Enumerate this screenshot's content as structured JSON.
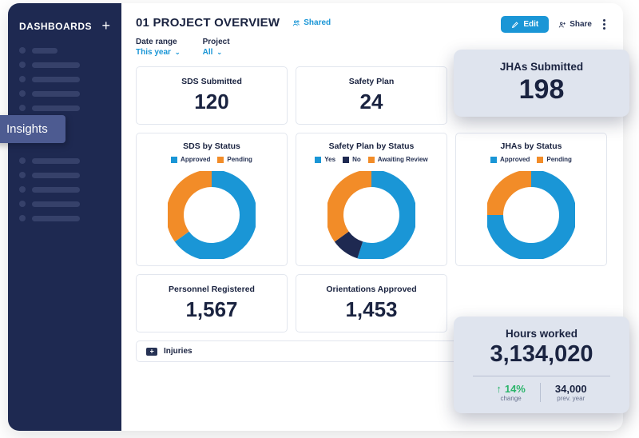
{
  "sidebar": {
    "title": "DASHBOARDS",
    "insights_label": "Insights"
  },
  "header": {
    "title": "01 PROJECT OVERVIEW",
    "shared_label": "Shared",
    "edit_label": "Edit",
    "share_label": "Share"
  },
  "filters": {
    "date_range_label": "Date range",
    "date_range_value": "This year",
    "project_label": "Project",
    "project_value": "All"
  },
  "stats": {
    "sds_submitted": {
      "title": "SDS Submitted",
      "value": "120"
    },
    "safety_plan": {
      "title": "Safety Plan",
      "value": "24"
    },
    "jhas_submitted": {
      "title": "JHAs Submitted",
      "value": "198"
    },
    "personnel": {
      "title": "Personnel Registered",
      "value": "1,567"
    },
    "orientations": {
      "title": "Orientations Approved",
      "value": "1,453"
    },
    "hours": {
      "title": "Hours worked",
      "value": "3,134,020",
      "change_pct": "14%",
      "change_label": "change",
      "prev_value": "34,000",
      "prev_label": "prev. year"
    },
    "injuries_title": "Injuries"
  },
  "charts": {
    "sds": {
      "title": "SDS by Status",
      "legend": [
        "Approved",
        "Pending"
      ]
    },
    "safety": {
      "title": "Safety Plan by Status",
      "legend": [
        "Yes",
        "No",
        "Awaiting Review"
      ]
    },
    "jhas": {
      "title": "JHAs by Status",
      "legend": [
        "Approved",
        "Pending"
      ]
    }
  },
  "colors": {
    "blue": "#1a96d6",
    "orange": "#f28c28",
    "navy": "#1e2951"
  },
  "chart_data": [
    {
      "type": "pie",
      "title": "SDS by Status",
      "series": [
        {
          "name": "Approved",
          "value": 65,
          "color": "#1a96d6"
        },
        {
          "name": "Pending",
          "value": 35,
          "color": "#f28c28"
        }
      ]
    },
    {
      "type": "pie",
      "title": "Safety Plan by Status",
      "series": [
        {
          "name": "Yes",
          "value": 55,
          "color": "#1a96d6"
        },
        {
          "name": "No",
          "value": 10,
          "color": "#1e2951"
        },
        {
          "name": "Awaiting Review",
          "value": 35,
          "color": "#f28c28"
        }
      ]
    },
    {
      "type": "pie",
      "title": "JHAs by Status",
      "series": [
        {
          "name": "Approved",
          "value": 75,
          "color": "#1a96d6"
        },
        {
          "name": "Pending",
          "value": 25,
          "color": "#f28c28"
        }
      ]
    }
  ]
}
